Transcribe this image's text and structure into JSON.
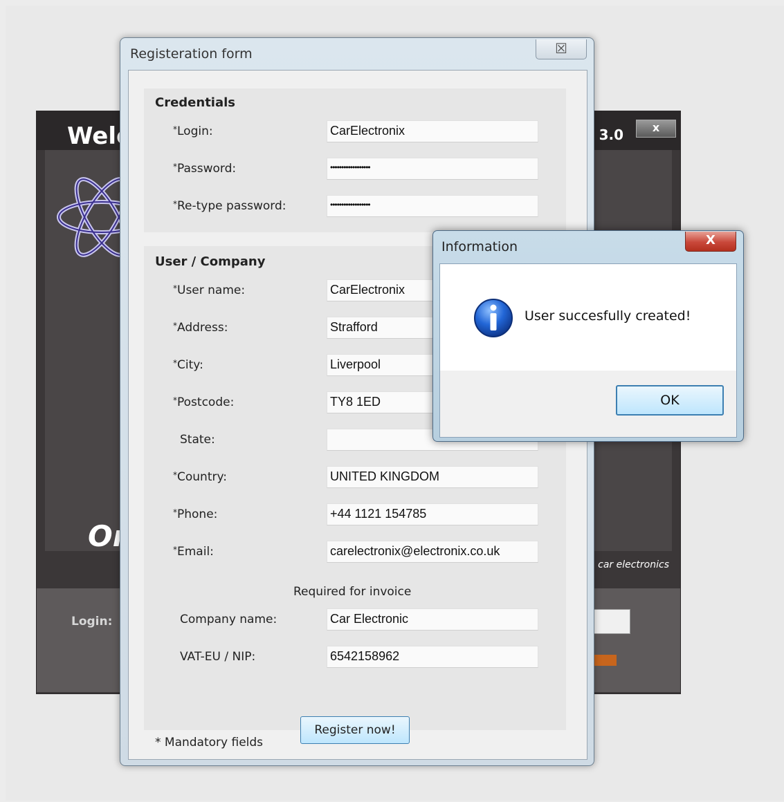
{
  "background_app": {
    "title": "Welc",
    "version": "3.0",
    "close_label": "x",
    "tagline": "On",
    "brand": "car electronics",
    "login_label": "Login:"
  },
  "registration": {
    "title": "Registeration form",
    "close_label": "☒",
    "credentials": {
      "title": "Credentials",
      "login_label": "Login:",
      "login_value": "CarElectronix",
      "password_label": "Password:",
      "password_value": "••••••••••••••••••",
      "retype_label": "Re-type password:",
      "retype_value": "••••••••••••••••••"
    },
    "company": {
      "title": "User / Company",
      "username_label": "User name:",
      "username_value": "CarElectronix",
      "address_label": "Address:",
      "address_value": "Strafford",
      "city_label": "City:",
      "city_value": "Liverpool",
      "postcode_label": "Postcode:",
      "postcode_value": "TY8 1ED",
      "state_label": "State:",
      "state_value": "",
      "country_label": "Country:",
      "country_value": "UNITED KINGDOM",
      "phone_label": "Phone:",
      "phone_value": "+44 1121 154785",
      "email_label": "Email:",
      "email_value": "carelectronix@electronix.co.uk"
    },
    "invoice": {
      "title": "Required for invoice",
      "company_label": "Company name:",
      "company_value": "Car Electronic",
      "vat_label": "VAT-EU / NIP:",
      "vat_value": "6542158962"
    },
    "required_marker": "*",
    "mandatory_note": "* Mandatory fields",
    "register_button": "Register now!"
  },
  "info_dialog": {
    "title": "Information",
    "close_label": "X",
    "message": "User succesfully created!",
    "ok_button": "OK",
    "icon": "info-icon"
  }
}
